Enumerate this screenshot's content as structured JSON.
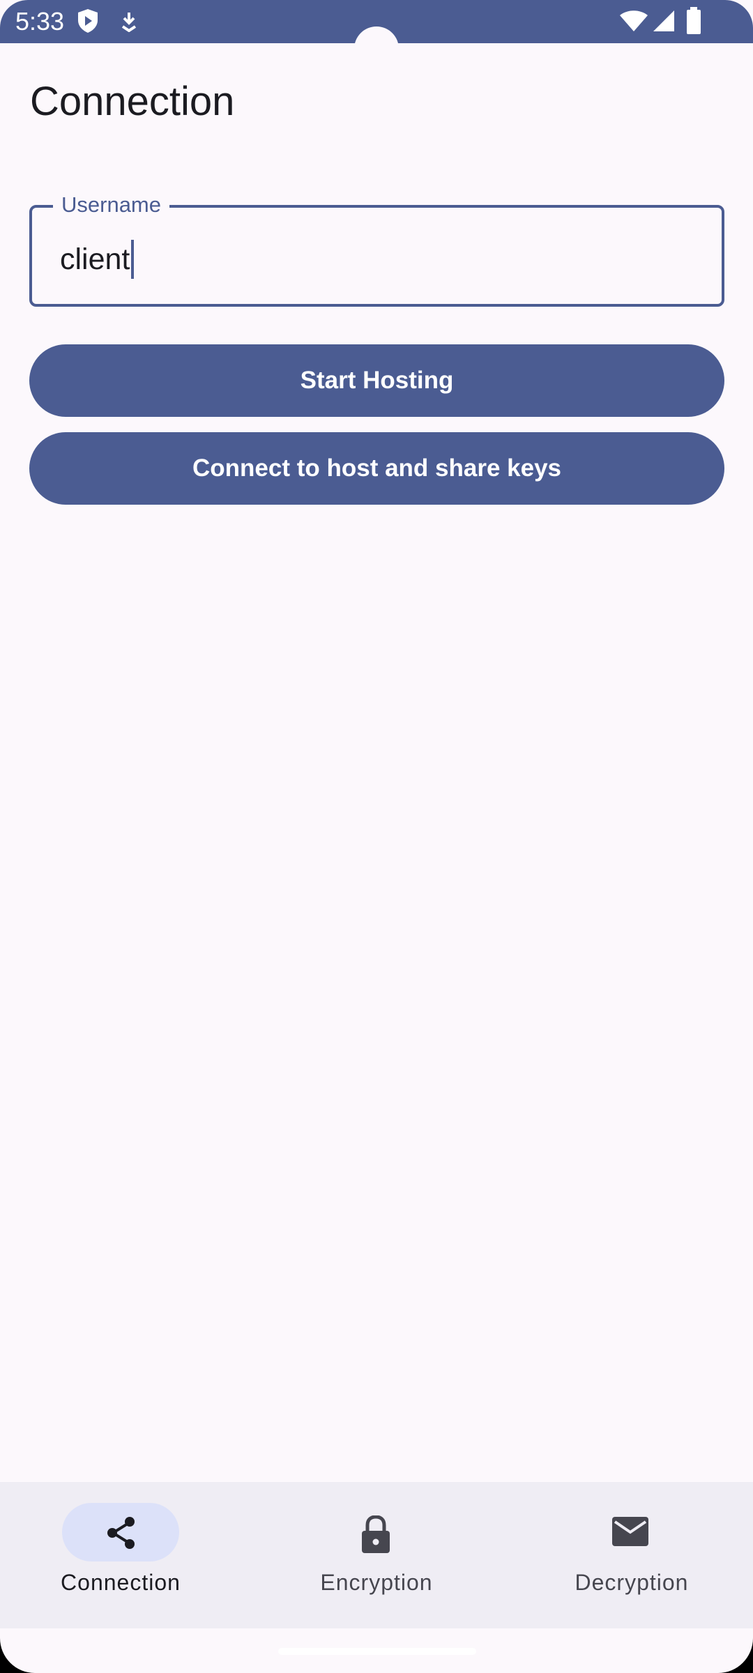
{
  "status_bar": {
    "time": "5:33",
    "icons": [
      "shield-play-icon",
      "download-icon",
      "wifi-icon",
      "signal-icon",
      "battery-icon"
    ]
  },
  "page": {
    "title": "Connection"
  },
  "username_field": {
    "label": "Username",
    "value": "client"
  },
  "buttons": {
    "start_hosting": "Start Hosting",
    "connect": "Connect to host and share keys"
  },
  "bottom_nav": {
    "items": [
      {
        "label": "Connection",
        "icon": "share-icon",
        "active": true
      },
      {
        "label": "Encryption",
        "icon": "lock-icon",
        "active": false
      },
      {
        "label": "Decryption",
        "icon": "mail-icon",
        "active": false
      }
    ]
  },
  "colors": {
    "primary": "#4b5c92",
    "background": "#fcf8fc",
    "nav_background": "#efedf4",
    "active_indicator": "#dce1f9"
  }
}
